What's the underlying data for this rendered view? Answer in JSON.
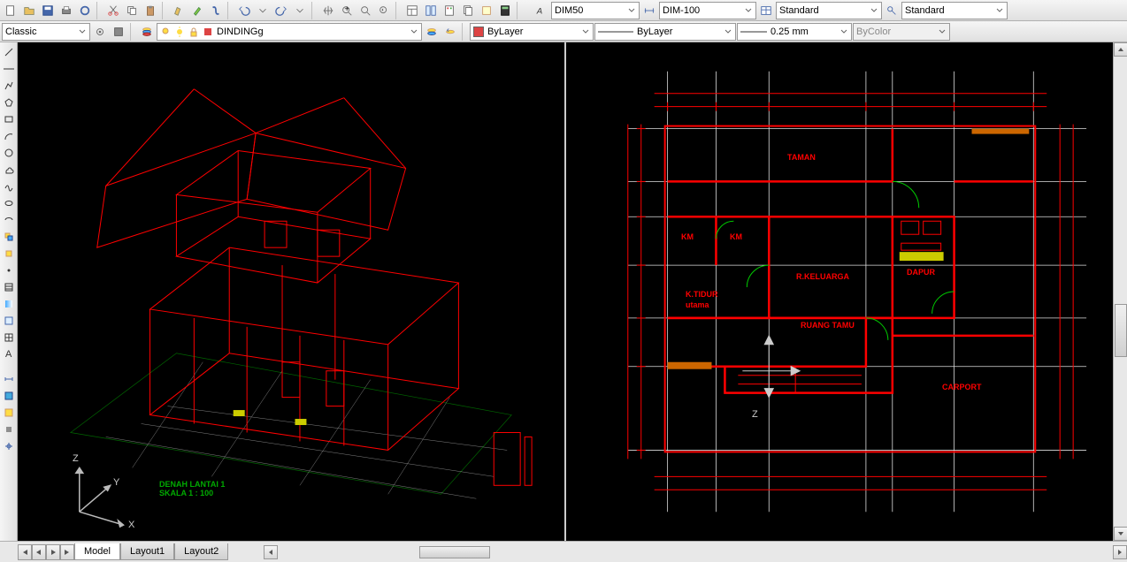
{
  "toolbar1": {
    "dimStyle": "DIM50",
    "dimStyle2": "DIM-100",
    "tableStyle": "Standard",
    "textStyle": "Standard"
  },
  "toolbar2": {
    "workspace": "Classic",
    "layerCurrent": "DINDINGg",
    "colorLabel": "ByLayer",
    "linetypeLabel": "ByLayer",
    "lineweightLabel": "0.25 mm",
    "plotStyleLabel": "ByColor"
  },
  "viewport1": {
    "titleLine1": "DENAH LANTAI 1",
    "titleLine2": "SKALA 1 : 100",
    "axisX": "X",
    "axisY": "Y",
    "axisZ": "Z"
  },
  "viewport2": {
    "rooms": {
      "taman": "TAMAN",
      "km1": "KM",
      "km2": "KM",
      "rkeluarga": "R.KELUARGA",
      "dapur": "DAPUR",
      "ktidur": "K.TIDUR",
      "utama": "utama",
      "ruangtamu": "RUANG TAMU",
      "carport": "CARPORT"
    },
    "axisZ": "Z"
  },
  "tabs": {
    "model": "Model",
    "layout1": "Layout1",
    "layout2": "Layout2"
  }
}
